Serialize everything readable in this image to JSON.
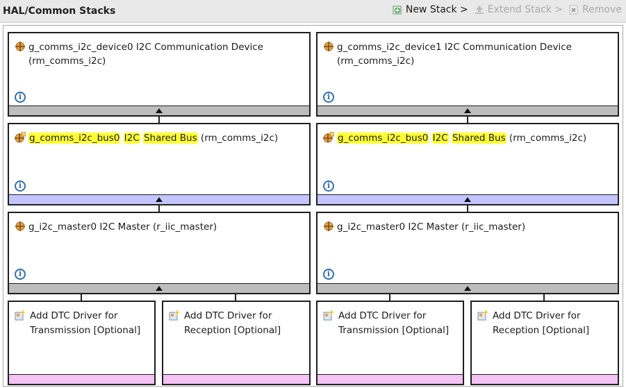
{
  "header": {
    "title": "HAL/Common Stacks",
    "new_stack": "New Stack >",
    "extend_stack": "Extend Stack >",
    "remove": "Remove"
  },
  "stacks": [
    {
      "device": {
        "name": "g_comms_i2c_device0 I2C Communication Device",
        "module": "(rm_comms_i2c)"
      },
      "bus": {
        "name_part": "g_comms_i2c_bus0",
        "label_a": "I2C",
        "label_b": "Shared Bus",
        "module": "(rm_comms_i2c)"
      },
      "master": {
        "name": "g_i2c_master0 I2C Master (r_iic_master)"
      },
      "dtc": [
        {
          "line1": "Add DTC Driver for",
          "line2": "Transmission [Optional]"
        },
        {
          "line1": "Add DTC Driver for",
          "line2": "Reception [Optional]"
        }
      ]
    },
    {
      "device": {
        "name": "g_comms_i2c_device1 I2C Communication Device",
        "module": "(rm_comms_i2c)"
      },
      "bus": {
        "name_part": "g_comms_i2c_bus0",
        "label_a": "I2C",
        "label_b": "Shared Bus",
        "module": "(rm_comms_i2c)"
      },
      "master": {
        "name": "g_i2c_master0 I2C Master (r_iic_master)"
      },
      "dtc": [
        {
          "line1": "Add DTC Driver for",
          "line2": "Transmission [Optional]"
        },
        {
          "line1": "Add DTC Driver for",
          "line2": "Reception [Optional]"
        }
      ]
    }
  ],
  "colors": {
    "highlight": "#ffff33",
    "bar_gray": "#bdbdbd",
    "bar_lavender": "#c4c4ff",
    "bar_pink": "#f4c2f4",
    "info_blue": "#2f6fb5"
  },
  "icons": {
    "module": "module-crosshair-icon",
    "shared_module": "shared-module-icon",
    "dtc_add": "add-driver-icon",
    "info": "info-icon",
    "new_stack": "new-stack-icon",
    "extend_stack": "extend-stack-icon",
    "remove": "remove-icon"
  }
}
